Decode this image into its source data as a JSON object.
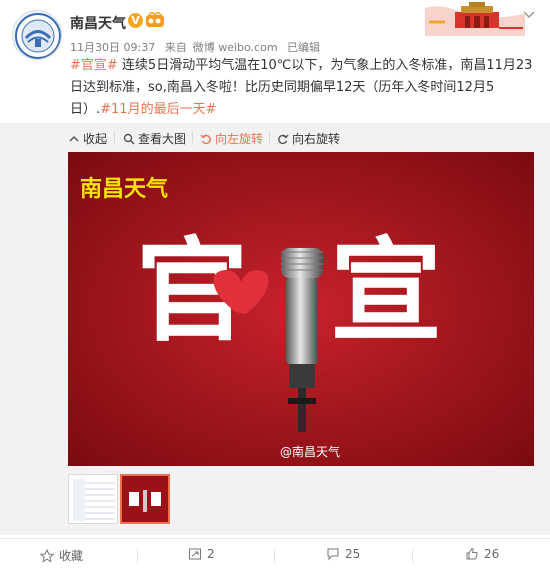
{
  "colors": {
    "accent": "#eb7350",
    "link": "#eb7350",
    "poster_bg": "#a3121a",
    "poster_title": "#f7e300"
  },
  "post": {
    "author": "南昌天气",
    "verified_icon": "verified-icon",
    "date": "11月30日 09:37",
    "source_prefix": "来自",
    "source": "微博 weibo.com",
    "edited": "已编辑",
    "tag": "#官宣#",
    "body": " 连续5日滑动平均气温在10℃以下，为气象上的入冬标准，南昌11月23日达到标准，so,南昌入冬啦！比历史同期偏早12天（历年入冬时间12月5日）.",
    "tag2": "#11月的最后一天#"
  },
  "toolbar": {
    "collapse": "收起",
    "view_large": "查看大图",
    "rotate_left": "向左旋转",
    "rotate_right": "向右旋转"
  },
  "image": {
    "title": "南昌天气",
    "char_left": "官",
    "char_right": "宣",
    "watermark": "@南昌天气"
  },
  "footer": {
    "favorite": "收藏",
    "forward_count": "2",
    "comment_count": "25",
    "like_count": "26"
  }
}
